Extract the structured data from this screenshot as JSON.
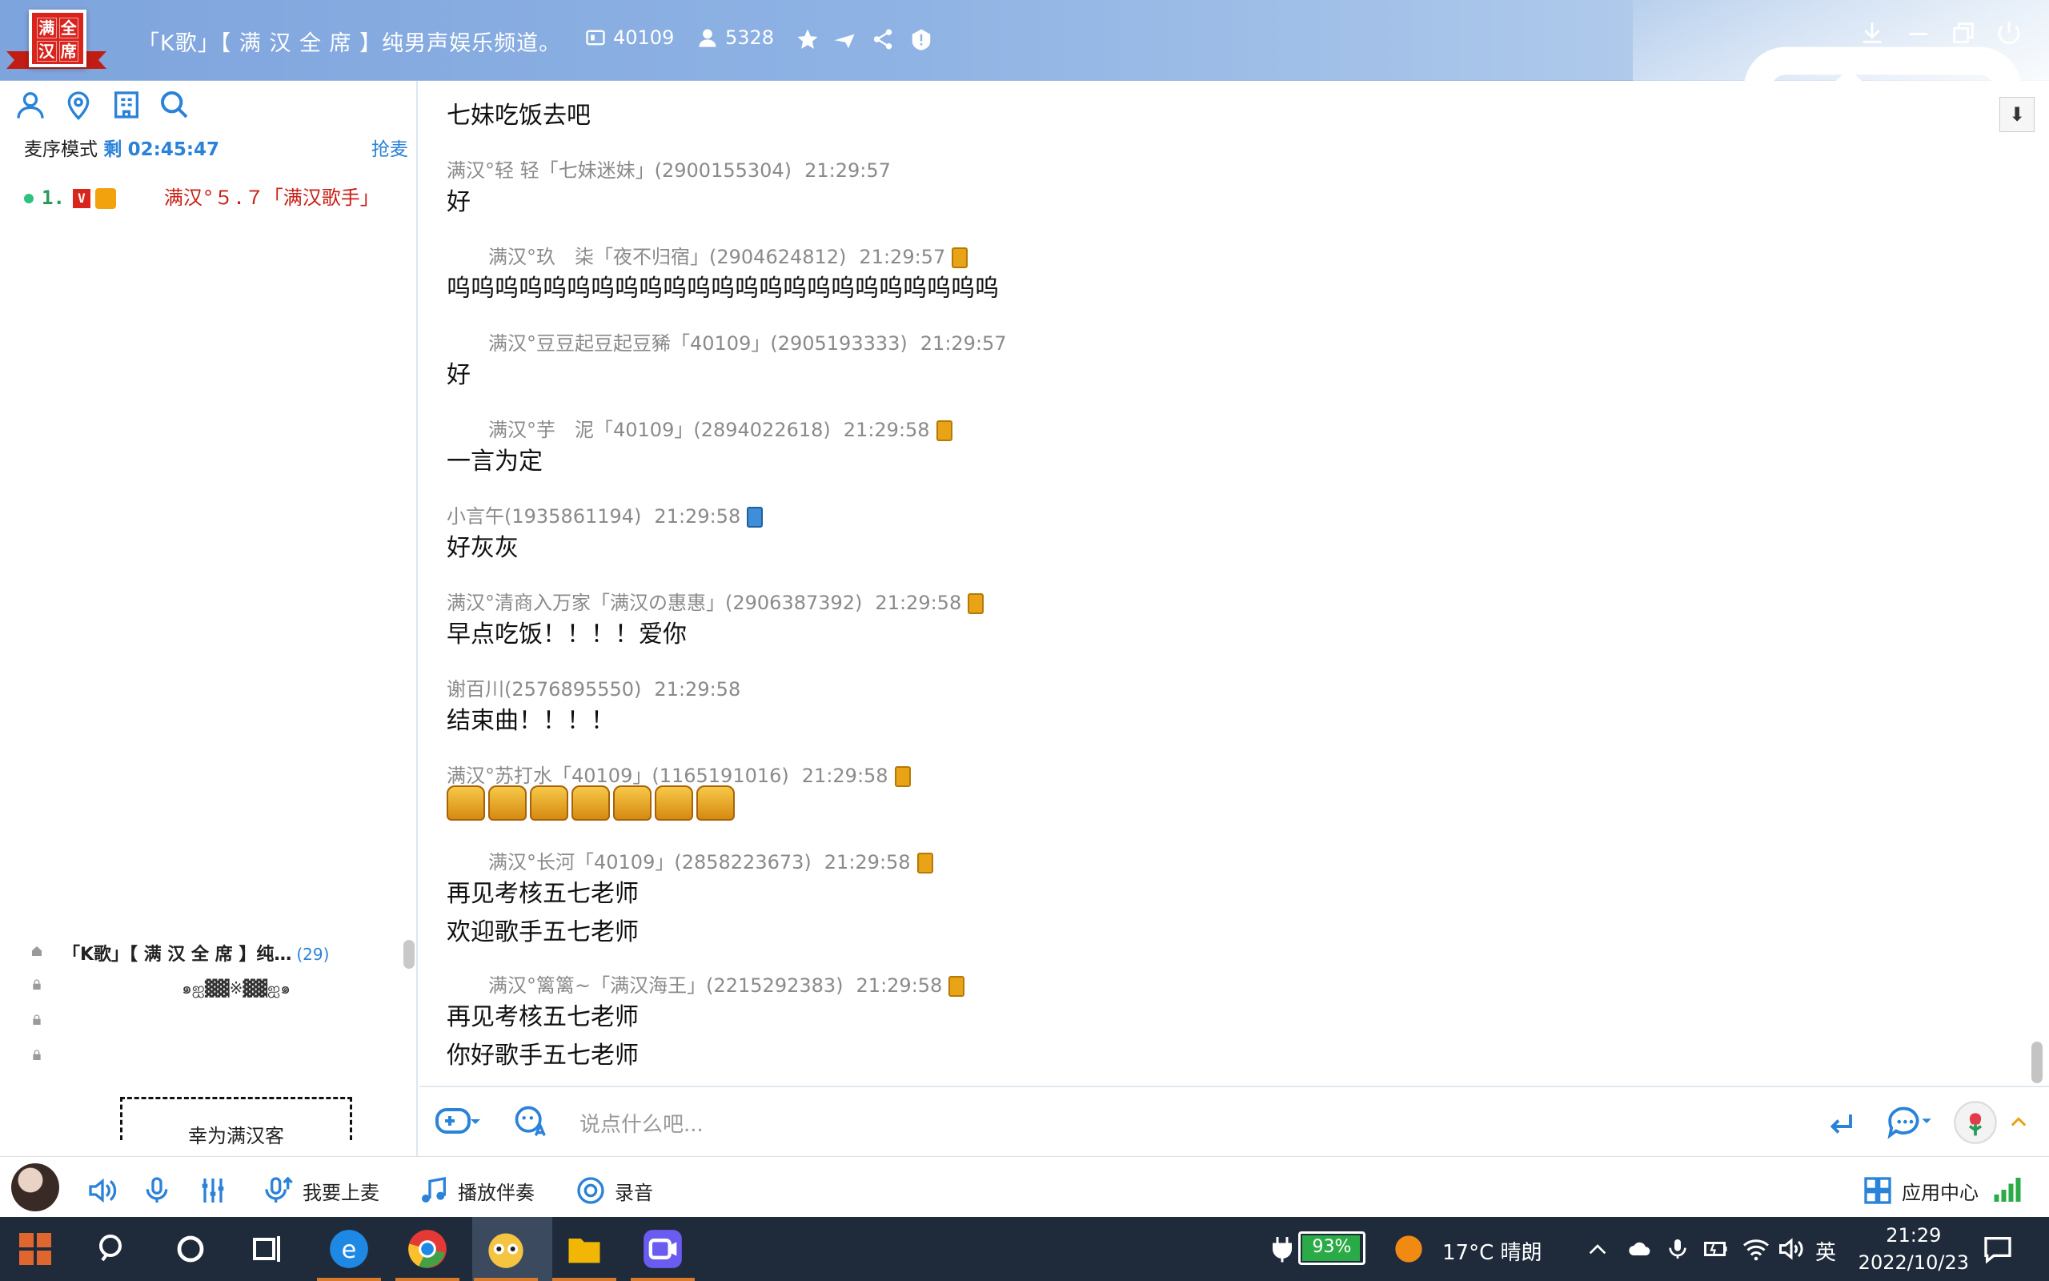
{
  "header": {
    "logo_chars": [
      "满",
      "全",
      "汉",
      "席"
    ],
    "channel_title": "「K歌」【 满 汉 全 席 】纯男声娱乐频道。",
    "room_id": "40109",
    "online_count": "5328",
    "icons": [
      "channel-id-icon",
      "user-icon",
      "star-icon",
      "plane-icon",
      "share-icon",
      "warning-icon",
      "video-icon",
      "home-icon",
      "list-icon",
      "gamepad-icon",
      "download-icon",
      "minimize-icon",
      "restore-icon",
      "power-icon"
    ]
  },
  "left_panel": {
    "toolbar_icons": [
      "user-icon",
      "location-icon",
      "building-icon",
      "search-icon"
    ],
    "queue_mode_label": "麦序模式",
    "remain_prefix": "剩",
    "remain_time": "02:45:47",
    "grab_mic": "抢麦",
    "mic_list": [
      {
        "index": "1.",
        "vip": "V",
        "name": "满汉°５.７「满汉歌手」"
      }
    ],
    "channels": [
      {
        "name": "「K歌」【 满 汉 全 席 】纯…",
        "count": "(29)"
      },
      {
        "name": "๑ஐ▓▓※▓▓ஐ๑"
      }
    ],
    "welcome_text": "幸为满汉客"
  },
  "chat": {
    "messages": [
      {
        "body": "七妹吃饭去吧"
      },
      {
        "sender": "满汉°轻 轻「七妹迷妹」(2900155304)",
        "time": "21:29:57",
        "body": "好"
      },
      {
        "sender": "满汉°玖　柒「夜不归宿」(2904624812)",
        "time": "21:29:57",
        "body": "呜呜呜呜呜呜呜呜呜呜呜呜呜呜呜呜呜呜呜呜呜呜呜"
      },
      {
        "sender": "满汉°豆豆起豆起豆豨「40109」(2905193333)",
        "time": "21:29:57",
        "body": "好"
      },
      {
        "sender": "满汉°芋　泥「40109」(2894022618)",
        "time": "21:29:58",
        "body": "一言为定"
      },
      {
        "sender": "小言午(1935861194)",
        "time": "21:29:58",
        "body": "好灰灰"
      },
      {
        "sender": "满汉°清商入万家「满汉の惠惠」(2906387392)",
        "time": "21:29:58",
        "body": "早点吃饭！！！！爱你"
      },
      {
        "sender": "谢百川(2576895550)",
        "time": "21:29:58",
        "body": "结束曲！！！！"
      },
      {
        "sender": "满汉°苏打水「40109」(1165191016)",
        "time": "21:29:58"
      },
      {
        "sender": "满汉°长河「40109」(2858223673)",
        "time": "21:29:58",
        "body": "再见考核五七老师",
        "body2": "欢迎歌手五七老师"
      },
      {
        "sender": "满汉°篱篱~「满汉海王」(2215292383)",
        "time": "21:29:58",
        "body": "再见考核五七老师",
        "body2": "你好歌手五七老师"
      }
    ]
  },
  "input": {
    "placeholder": "说点什么吧...",
    "icons": [
      "gamepad-icon",
      "translate-icon",
      "send-icon",
      "chat-bubble-icon",
      "flower-icon",
      "chevron-up-icon"
    ]
  },
  "controlbar": {
    "mic_up": "我要上麦",
    "play_accompaniment": "播放伴奏",
    "record": "录音",
    "app_center": "应用中心"
  },
  "taskbar": {
    "battery": "93%",
    "weather": "17°C 晴朗",
    "ime": "英",
    "time": "21:29",
    "date": "2022/10/23"
  },
  "colors": {
    "header_bg": "#8fb3e4",
    "accent_blue": "#2b82d9",
    "mic_name_red": "#c81e14",
    "taskbar_bg": "#1f2b3b"
  }
}
